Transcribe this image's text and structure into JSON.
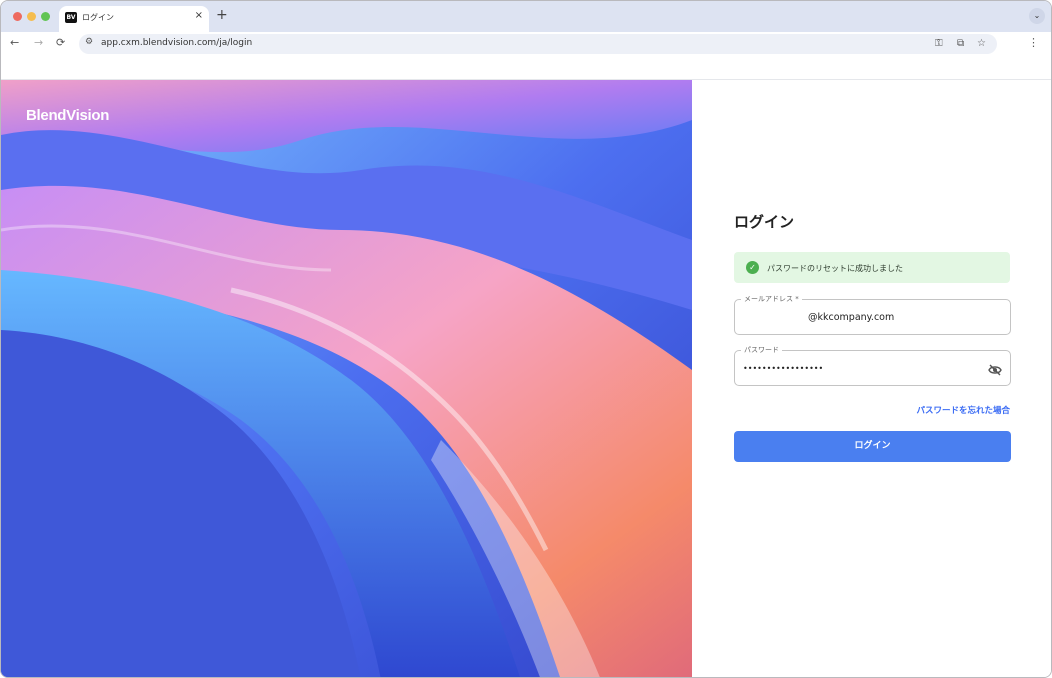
{
  "browser": {
    "tab": {
      "title": "ログイン",
      "favicon_text": "BV",
      "close": "×"
    },
    "new_tab": "+",
    "tab_menu": "⌄",
    "back": "←",
    "forward": "→",
    "reload": "⟳",
    "site_info": "⚙",
    "url": "app.cxm.blendvision.com/ja/login",
    "key_icon": "⚿",
    "install_icon": "⧉",
    "bookmark_icon": "☆",
    "menu": "⋮"
  },
  "hero": {
    "logo": "BlendVision"
  },
  "login": {
    "title": "ログイン",
    "alert": {
      "icon": "✓",
      "message": "パスワードのリセットに成功しました"
    },
    "email": {
      "label": "メールアドレス *",
      "value": "@kkcompany.com"
    },
    "password": {
      "label": "パスワード",
      "value": "•••••••••••••••••"
    },
    "forgot_link": "パスワードを忘れた場合",
    "submit": "ログイン"
  }
}
